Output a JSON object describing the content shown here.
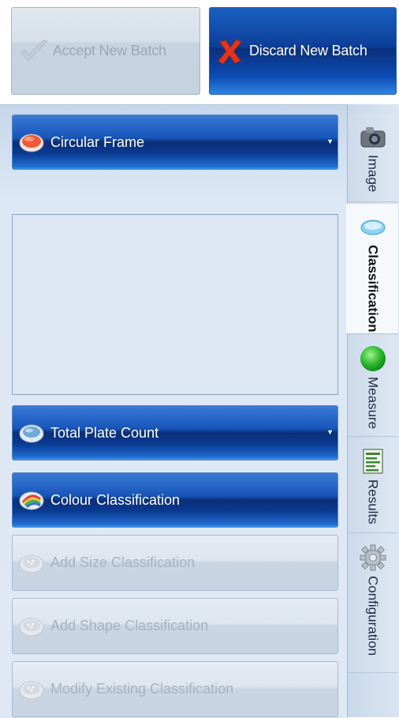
{
  "top_buttons": {
    "accept_label": "Accept New Batch",
    "discard_label": "Discard New Batch"
  },
  "frame_dropdown": {
    "label": "Circular Frame",
    "icon": "red-circle-icon"
  },
  "count_dropdown": {
    "label": "Total Plate Count",
    "icon": "petri-dish-icon"
  },
  "colour_button": {
    "label": "Colour Classification",
    "icon": "rainbow-dish-icon"
  },
  "disabled_buttons": [
    {
      "label": "Add Size Classification"
    },
    {
      "label": "Add Shape Classification"
    },
    {
      "label": "Modify Existing Classification"
    }
  ],
  "tabs": [
    {
      "label": "Image",
      "icon": "camera-icon"
    },
    {
      "label": "Classification",
      "icon": "petri-dish-icon",
      "active": true
    },
    {
      "label": "Measure",
      "icon": "green-ball-icon"
    },
    {
      "label": "Results",
      "icon": "spreadsheet-icon"
    },
    {
      "label": "Configuration",
      "icon": "gear-icon"
    }
  ],
  "colors": {
    "active_blue": "#0a317d",
    "disabled_text": "#a7b3c0",
    "panel_bg": "#dde8f5"
  }
}
